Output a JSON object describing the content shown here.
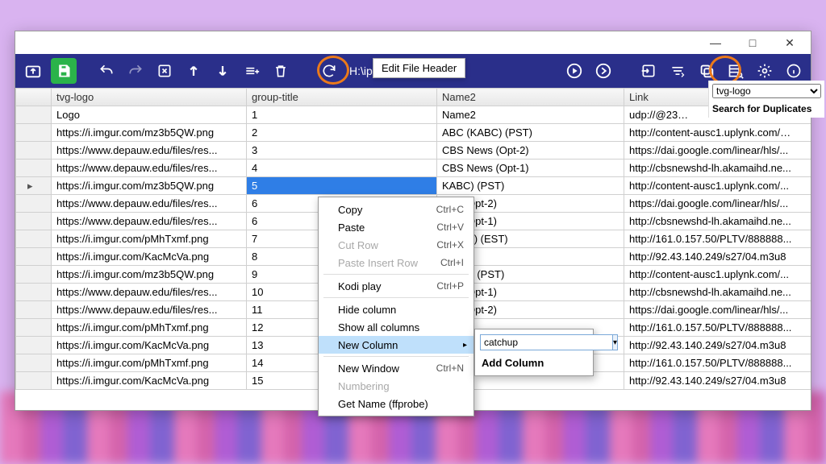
{
  "titlebar": {
    "min": "—",
    "max": "□",
    "close": "✕"
  },
  "toolbar": {
    "path": "H:\\iptv_test.m3u",
    "edit_header_popup": "Edit File Header"
  },
  "columns": {
    "gutter": "",
    "logo": "tvg-logo",
    "group": "group-title",
    "name": "Name2",
    "link": "Link"
  },
  "rows": [
    {
      "logo": "Logo",
      "group": "1",
      "name": "Name2",
      "link": "udp://@23…",
      "sel": false
    },
    {
      "logo": "https://i.imgur.com/mz3b5QW.png",
      "group": "2",
      "name": "ABC (KABC) (PST)",
      "link": "http://content-ausc1.uplynk.com/…",
      "sel": false
    },
    {
      "logo": "https://www.depauw.edu/files/res...",
      "group": "3",
      "name": "CBS News (Opt-2)",
      "link": "https://dai.google.com/linear/hls/...",
      "sel": false
    },
    {
      "logo": "https://www.depauw.edu/files/res...",
      "group": "4",
      "name": "CBS News (Opt-1)",
      "link": "http://cbsnewshd-lh.akamaihd.ne...",
      "sel": false
    },
    {
      "logo": "https://i.imgur.com/mz3b5QW.png",
      "group": "5",
      "name": "KABC) (PST)",
      "link": "http://content-ausc1.uplynk.com/...",
      "sel": true
    },
    {
      "logo": "https://www.depauw.edu/files/res...",
      "group": "6",
      "name": "ews (Opt-2)",
      "link": "https://dai.google.com/linear/hls/...",
      "sel": false
    },
    {
      "logo": "https://www.depauw.edu/files/res...",
      "group": "6",
      "name": "ews (Opt-1)",
      "link": "http://cbsnewshd-lh.akamaihd.ne...",
      "sel": false
    },
    {
      "logo": "https://i.imgur.com/pMhTxmf.png",
      "group": "7",
      "name": "WFOR) (EST)",
      "link": "http://161.0.157.50/PLTV/888888...",
      "sel": false
    },
    {
      "logo": "https://i.imgur.com/KacMcVa.png",
      "group": "8",
      "name": "",
      "link": "http://92.43.140.249/s27/04.m3u8",
      "sel": false
    },
    {
      "logo": "https://i.imgur.com/mz3b5QW.png",
      "group": "9",
      "name": "KABC) (PST)",
      "link": "http://content-ausc1.uplynk.com/...",
      "sel": false
    },
    {
      "logo": "https://www.depauw.edu/files/res...",
      "group": "10",
      "name": "ews (Opt-1)",
      "link": "http://cbsnewshd-lh.akamaihd.ne...",
      "sel": false
    },
    {
      "logo": "https://www.depauw.edu/files/res...",
      "group": "11",
      "name": "ews (Opt-2)",
      "link": "https://dai.google.com/linear/hls/...",
      "sel": false
    },
    {
      "logo": "https://i.imgur.com/pMhTxmf.png",
      "group": "12",
      "name": "",
      "link": "http://161.0.157.50/PLTV/888888...",
      "sel": false
    },
    {
      "logo": "https://i.imgur.com/KacMcVa.png",
      "group": "13",
      "name": "",
      "link": "http://92.43.140.249/s27/04.m3u8",
      "sel": false
    },
    {
      "logo": "https://i.imgur.com/pMhTxmf.png",
      "group": "14",
      "name": "WFOR) (EST)",
      "link": "http://161.0.157.50/PLTV/888888...",
      "sel": false
    },
    {
      "logo": "https://i.imgur.com/KacMcVa.png",
      "group": "15",
      "name": "",
      "link": "http://92.43.140.249/s27/04.m3u8",
      "sel": false
    }
  ],
  "rightpanel": {
    "dropdown_value": "tvg-logo",
    "action": "Search for Duplicates"
  },
  "context_menu": [
    {
      "label": "Copy",
      "shortcut": "Ctrl+C",
      "disabled": false
    },
    {
      "label": "Paste",
      "shortcut": "Ctrl+V",
      "disabled": false
    },
    {
      "label": "Cut Row",
      "shortcut": "Ctrl+X",
      "disabled": true
    },
    {
      "label": "Paste Insert Row",
      "shortcut": "Ctrl+I",
      "disabled": true
    },
    {
      "sep": true
    },
    {
      "label": "Kodi play",
      "shortcut": "Ctrl+P",
      "disabled": false
    },
    {
      "sep": true
    },
    {
      "label": "Hide column",
      "disabled": false
    },
    {
      "label": "Show all columns",
      "disabled": false
    },
    {
      "label": "New Column",
      "disabled": false,
      "submenu": true,
      "hover": true
    },
    {
      "sep": true
    },
    {
      "label": "New Window",
      "shortcut": "Ctrl+N",
      "disabled": false
    },
    {
      "label": "Numbering",
      "disabled": true
    },
    {
      "label": "Get Name (ffprobe)",
      "disabled": false
    }
  ],
  "submenu": {
    "input_value": "catchup",
    "add_label": "Add Column"
  }
}
